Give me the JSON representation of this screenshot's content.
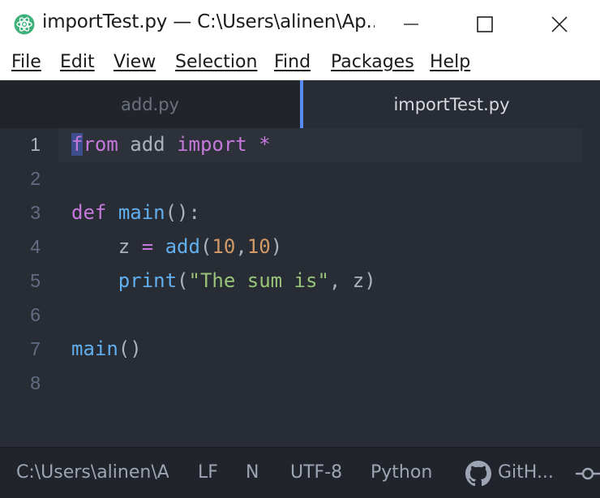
{
  "window": {
    "title": "importTest.py — C:\\Users\\alinen\\Ap...",
    "icon": "atom-icon"
  },
  "menu": [
    "File",
    "Edit",
    "View",
    "Selection",
    "Find",
    "Packages",
    "Help"
  ],
  "tabs": [
    {
      "label": "add.py",
      "active": false
    },
    {
      "label": "importTest.py",
      "active": true
    }
  ],
  "editor": {
    "line_numbers": [
      "1",
      "2",
      "3",
      "4",
      "5",
      "6",
      "7",
      "8"
    ],
    "lines": [
      "from add import *",
      "",
      "def main():",
      "    z = add(10,10)",
      "    print(\"The sum is\", z)",
      "",
      "main()",
      ""
    ],
    "current_line": 1
  },
  "status": {
    "path": "C:\\Users\\alinen\\Ap",
    "line_ending": "LF",
    "indicator": "N",
    "encoding": "UTF-8",
    "grammar": "Python",
    "github": "GitH..."
  },
  "colors": {
    "keyword": "#c678dd",
    "function": "#61afef",
    "number": "#d19a66",
    "string": "#98c379",
    "text": "#abb2bf",
    "active_tab_accent": "#568af2"
  }
}
